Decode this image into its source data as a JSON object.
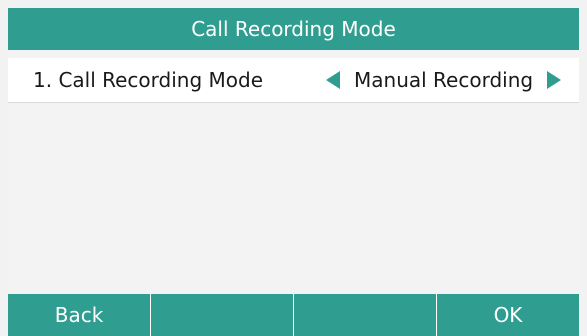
{
  "title": "Call Recording Mode",
  "row": {
    "label": "1. Call Recording Mode",
    "value": "Manual Recording"
  },
  "softkeys": [
    "Back",
    "",
    "",
    "OK"
  ],
  "colors": {
    "accent": "#2f9d8f",
    "background": "#f2f2f2",
    "row_background": "#ffffff"
  },
  "icons": {
    "left": "triangle-left-icon",
    "right": "triangle-right-icon"
  }
}
